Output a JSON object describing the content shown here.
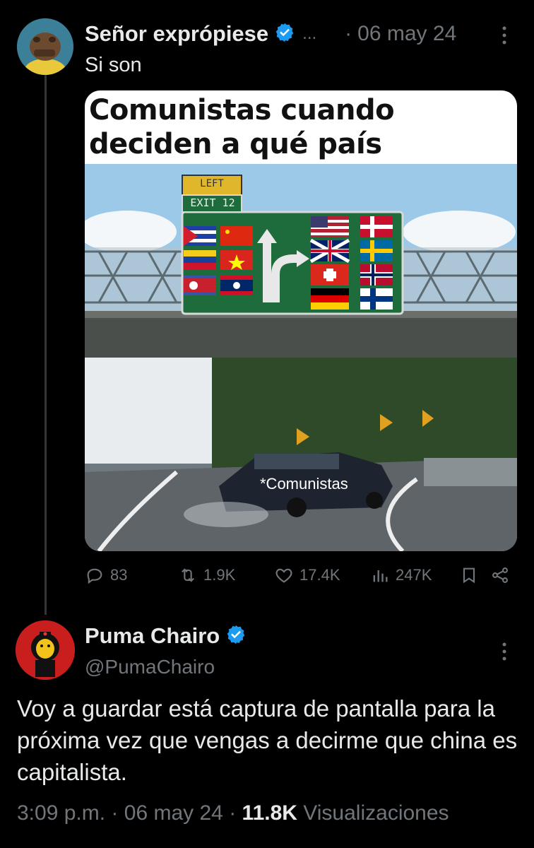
{
  "tweet": {
    "author_name": "Señor exprópiese",
    "ellipsis": "...",
    "dot": "·",
    "date": "06 may 24",
    "text": "Si son",
    "meme": {
      "title": "Comunistas cuando deciden a qué país emigrar...",
      "sign_top": "LEFT",
      "sign_exit": "EXIT 12",
      "car_label": "*Comunistas"
    },
    "stats": {
      "replies": "83",
      "retweets": "1.9K",
      "likes": "17.4K",
      "views": "247K"
    }
  },
  "reply": {
    "author_name": "Puma Chairo",
    "handle": "@PumaChairo",
    "text": "Voy a guardar está captura de pantalla para la próxima vez que vengas a decirme que china es capitalista.",
    "time": "3:09 p.m.",
    "sep": "·",
    "date": "06 may 24",
    "views_count": "11.8K",
    "views_label": "Visualizaciones"
  },
  "colors": {
    "accent": "#1d9bf0",
    "muted": "#71767b",
    "text": "#e7e9ea"
  }
}
